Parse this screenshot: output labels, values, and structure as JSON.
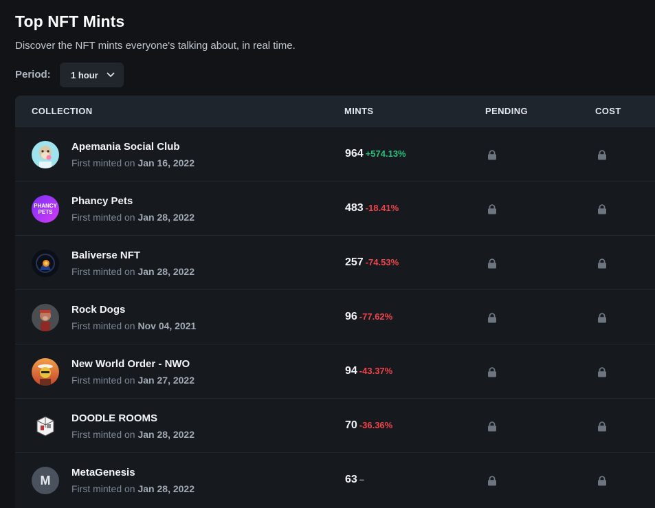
{
  "header": {
    "title": "Top NFT Mints",
    "subtitle": "Discover the NFT mints everyone's talking about, in real time."
  },
  "period": {
    "label": "Period:",
    "selected": "1 hour"
  },
  "table": {
    "columns": {
      "collection": "COLLECTION",
      "mints": "MINTS",
      "pending": "PENDING",
      "cost": "COST"
    },
    "minted_prefix": "First minted on",
    "rows": [
      {
        "name": "Apemania Social Club",
        "date": "Jan 16, 2022",
        "mints": "964",
        "change": "+574.13%",
        "trend": "up",
        "avatar_icon": "ape-avatar-icon",
        "avatar_text": ""
      },
      {
        "name": "Phancy Pets",
        "date": "Jan 28, 2022",
        "mints": "483",
        "change": "-18.41%",
        "trend": "down",
        "avatar_icon": "phancy-pets-logo-icon",
        "avatar_text": "PHANCY PETS"
      },
      {
        "name": "Baliverse NFT",
        "date": "Jan 28, 2022",
        "mints": "257",
        "change": "-74.53%",
        "trend": "down",
        "avatar_icon": "baliverse-avatar-icon",
        "avatar_text": ""
      },
      {
        "name": "Rock Dogs",
        "date": "Nov 04, 2021",
        "mints": "96",
        "change": "-77.62%",
        "trend": "down",
        "avatar_icon": "dog-avatar-icon",
        "avatar_text": ""
      },
      {
        "name": "New World Order - NWO",
        "date": "Jan 27, 2022",
        "mints": "94",
        "change": "-43.37%",
        "trend": "down",
        "avatar_icon": "nwo-avatar-icon",
        "avatar_text": ""
      },
      {
        "name": "DOODLE ROOMS",
        "date": "Jan 28, 2022",
        "mints": "70",
        "change": "-36.36%",
        "trend": "down",
        "avatar_icon": "doodle-room-avatar-icon",
        "avatar_text": ""
      },
      {
        "name": "MetaGenesis",
        "date": "Jan 28, 2022",
        "mints": "63",
        "change": "–",
        "trend": "flat",
        "avatar_icon": "letter-avatar-icon",
        "avatar_text": "M"
      }
    ]
  },
  "colors": {
    "background": "#111316",
    "table_bg": "#161a1f",
    "header_bg": "#1e252d",
    "positive": "#28c17e",
    "negative": "#f0444a"
  }
}
